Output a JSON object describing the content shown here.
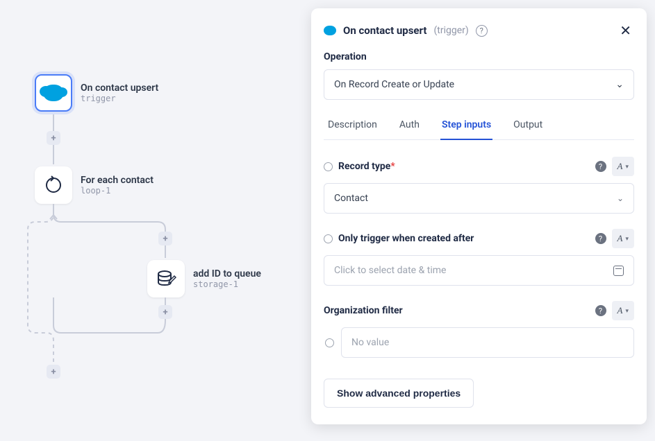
{
  "flow": {
    "node1": {
      "title": "On contact upsert",
      "subtitle": "trigger"
    },
    "node2": {
      "title": "For each contact",
      "subtitle": "loop-1"
    },
    "node3": {
      "title": "add ID to queue",
      "subtitle": "storage-1"
    }
  },
  "panel": {
    "title": "On contact upsert",
    "tag": "(trigger)",
    "operation_label": "Operation",
    "operation_value": "On Record Create or Update",
    "tabs": {
      "description": "Description",
      "auth": "Auth",
      "step_inputs": "Step inputs",
      "output": "Output"
    },
    "fields": {
      "record_type": {
        "label": "Record type",
        "value": "Contact"
      },
      "trigger_after": {
        "label": "Only trigger when created after",
        "placeholder": "Click to select date & time"
      },
      "org_filter": {
        "label": "Organization filter",
        "placeholder": "No value"
      }
    },
    "advanced_btn": "Show advanced properties",
    "type_glyph": "A"
  }
}
